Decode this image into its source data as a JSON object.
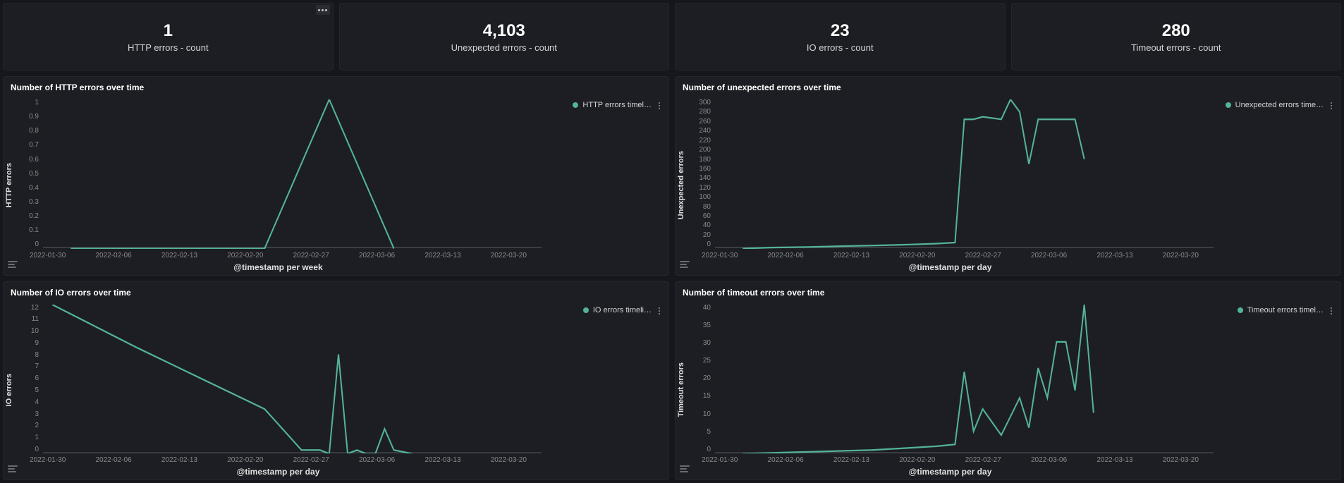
{
  "colors": {
    "accent": "#54b399",
    "panel_bg": "#1d1e24",
    "page_bg": "#16171c"
  },
  "metrics": [
    {
      "value": "1",
      "label": "HTTP errors - count"
    },
    {
      "value": "4,103",
      "label": "Unexpected errors - count"
    },
    {
      "value": "23",
      "label": "IO errors - count"
    },
    {
      "value": "280",
      "label": "Timeout errors - count"
    }
  ],
  "charts": [
    {
      "title": "Number of HTTP errors over time",
      "ylabel": "HTTP errors",
      "xlabel": "@timestamp per week",
      "legend": "HTTP errors timel…",
      "y_ticks": [
        "1",
        "0.9",
        "0.8",
        "0.7",
        "0.6",
        "0.5",
        "0.4",
        "0.3",
        "0.2",
        "0.1",
        "0"
      ],
      "x_ticks": [
        "2022-01-30",
        "2022-02-06",
        "2022-02-13",
        "2022-02-20",
        "2022-02-27",
        "2022-03-06",
        "2022-03-13",
        "2022-03-20"
      ]
    },
    {
      "title": "Number of unexpected errors over time",
      "ylabel": "Unexpected errors",
      "xlabel": "@timestamp per day",
      "legend": "Unexpected errors time…",
      "y_ticks": [
        "300",
        "280",
        "260",
        "240",
        "220",
        "200",
        "180",
        "160",
        "140",
        "120",
        "100",
        "80",
        "60",
        "40",
        "20",
        "0"
      ],
      "x_ticks": [
        "2022-01-30",
        "2022-02-06",
        "2022-02-13",
        "2022-02-20",
        "2022-02-27",
        "2022-03-06",
        "2022-03-13",
        "2022-03-20"
      ]
    },
    {
      "title": "Number of IO errors over time",
      "ylabel": "IO errors",
      "xlabel": "@timestamp per day",
      "legend": "IO errors timeli…",
      "y_ticks": [
        "12",
        "11",
        "10",
        "9",
        "8",
        "7",
        "6",
        "5",
        "4",
        "3",
        "2",
        "1",
        "0"
      ],
      "x_ticks": [
        "2022-01-30",
        "2022-02-06",
        "2022-02-13",
        "2022-02-20",
        "2022-02-27",
        "2022-03-06",
        "2022-03-13",
        "2022-03-20"
      ]
    },
    {
      "title": "Number of timeout errors over time",
      "ylabel": "Timeout errors",
      "xlabel": "@timestamp per day",
      "legend": "Timeout errors timel…",
      "y_ticks": [
        "40",
        "35",
        "30",
        "25",
        "20",
        "15",
        "10",
        "5",
        "0"
      ],
      "x_ticks": [
        "2022-01-30",
        "2022-02-06",
        "2022-02-13",
        "2022-02-20",
        "2022-02-27",
        "2022-03-06",
        "2022-03-13",
        "2022-03-20"
      ]
    }
  ],
  "chart_data": [
    {
      "type": "line",
      "title": "Number of HTTP errors over time",
      "xlabel": "@timestamp per week",
      "ylabel": "HTTP errors",
      "ylim": [
        0,
        1
      ],
      "x": [
        "2022-01-30",
        "2022-02-06",
        "2022-02-13",
        "2022-02-20",
        "2022-02-27",
        "2022-03-06"
      ],
      "series": [
        {
          "name": "HTTP errors timeline",
          "values": [
            0,
            0,
            0,
            0,
            1,
            0
          ]
        }
      ]
    },
    {
      "type": "line",
      "title": "Number of unexpected errors over time",
      "xlabel": "@timestamp per day",
      "ylabel": "Unexpected errors",
      "ylim": [
        0,
        300
      ],
      "x": [
        "2022-01-30",
        "2022-02-02",
        "2022-02-06",
        "2022-02-10",
        "2022-02-13",
        "2022-02-17",
        "2022-02-20",
        "2022-02-22",
        "2022-02-23",
        "2022-02-24",
        "2022-02-25",
        "2022-02-27",
        "2022-02-28",
        "2022-03-01",
        "2022-03-02",
        "2022-03-03",
        "2022-03-04",
        "2022-03-05",
        "2022-03-06",
        "2022-03-07",
        "2022-03-08"
      ],
      "series": [
        {
          "name": "Unexpected errors timeline",
          "values": [
            0,
            2,
            3,
            5,
            6,
            8,
            10,
            12,
            260,
            260,
            265,
            260,
            300,
            275,
            170,
            260,
            260,
            260,
            260,
            260,
            180
          ]
        }
      ]
    },
    {
      "type": "line",
      "title": "Number of IO errors over time",
      "xlabel": "@timestamp per day",
      "ylabel": "IO errors",
      "ylim": [
        0,
        12
      ],
      "x": [
        "2022-01-28",
        "2022-02-06",
        "2022-02-13",
        "2022-02-20",
        "2022-02-24",
        "2022-02-26",
        "2022-02-27",
        "2022-02-28",
        "2022-03-01",
        "2022-03-02",
        "2022-03-03",
        "2022-03-04",
        "2022-03-05",
        "2022-03-06",
        "2022-03-08"
      ],
      "series": [
        {
          "name": "IO errors timeline",
          "values": [
            12,
            8.6,
            6.1,
            3.6,
            0.3,
            0.3,
            0,
            8,
            0,
            0.3,
            0,
            0,
            2,
            0.3,
            0
          ]
        }
      ]
    },
    {
      "type": "line",
      "title": "Number of timeout errors over time",
      "xlabel": "@timestamp per day",
      "ylabel": "Timeout errors",
      "ylim": [
        0,
        40
      ],
      "x": [
        "2022-01-30",
        "2022-02-06",
        "2022-02-13",
        "2022-02-20",
        "2022-02-22",
        "2022-02-23",
        "2022-02-24",
        "2022-02-25",
        "2022-02-27",
        "2022-02-28",
        "2022-03-01",
        "2022-03-02",
        "2022-03-03",
        "2022-03-04",
        "2022-03-05",
        "2022-03-06",
        "2022-03-07",
        "2022-03-08",
        "2022-03-09"
      ],
      "series": [
        {
          "name": "Timeout errors timeline",
          "values": [
            0,
            0.5,
            1,
            2,
            2.5,
            22,
            6,
            12,
            5,
            10,
            15,
            7,
            23,
            15,
            30,
            30,
            17,
            40,
            11
          ]
        }
      ]
    }
  ]
}
